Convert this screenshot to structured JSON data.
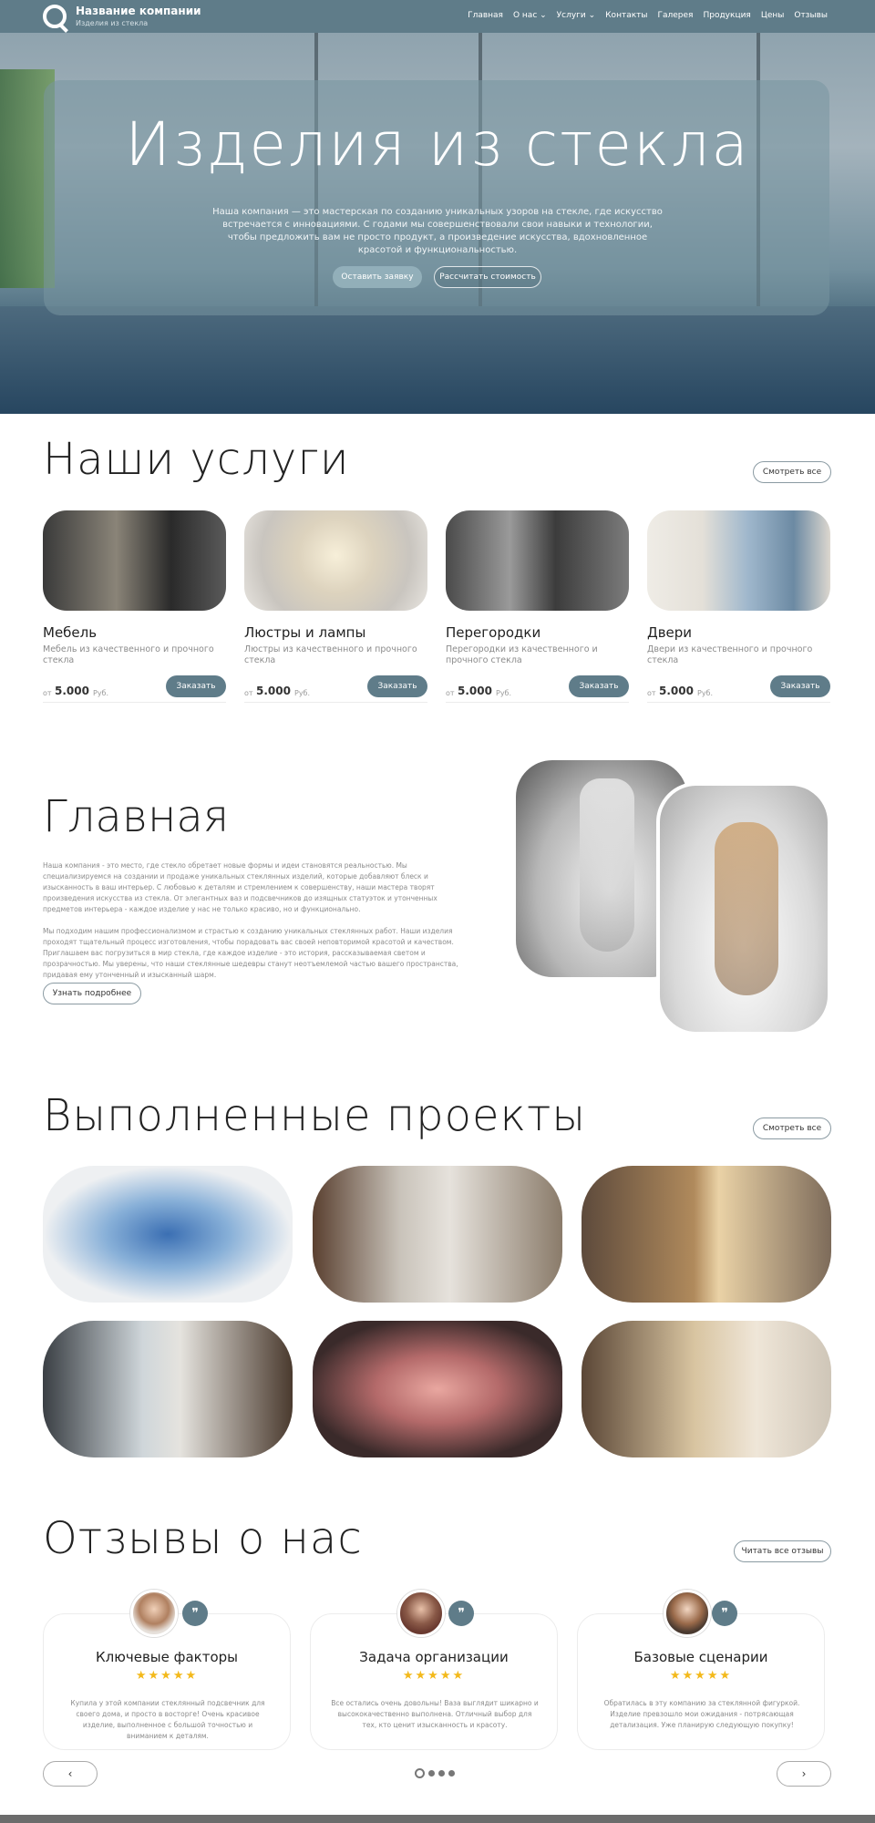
{
  "header": {
    "company_name": "Название компании",
    "company_tagline": "Изделия из стекла",
    "nav": [
      "Главная",
      "О нас ⌄",
      "Услуги ⌄",
      "Контакты",
      "Галерея",
      "Продукция",
      "Цены",
      "Отзывы"
    ]
  },
  "hero": {
    "title": "Изделия из стекла",
    "text": "Наша компания — это мастерская по созданию уникальных узоров на стекле, где искусство встречается с инновациями. С годами мы совершенствовали свои навыки и технологии, чтобы предложить вам не просто продукт, а произведение искусства, вдохновленное красотой и функциональностью.",
    "primary_button": "Оставить заявку",
    "secondary_button": "Рассчитать стоимость"
  },
  "services": {
    "title": "Наши услуги",
    "view_all": "Смотреть все",
    "items": [
      {
        "name": "Мебель",
        "desc": "Мебель из качественного и прочного стекла",
        "from": "от",
        "price": "5.000",
        "currency": "Руб.",
        "order": "Заказать"
      },
      {
        "name": "Люстры и лампы",
        "desc": "Люстры из качественного и прочного стекла",
        "from": "от",
        "price": "5.000",
        "currency": "Руб.",
        "order": "Заказать"
      },
      {
        "name": "Перегородки",
        "desc": "Перегородки из качественного и прочного стекла",
        "from": "от",
        "price": "5.000",
        "currency": "Руб.",
        "order": "Заказать"
      },
      {
        "name": "Двери",
        "desc": "Двери из качественного и прочного стекла",
        "from": "от",
        "price": "5.000",
        "currency": "Руб.",
        "order": "Заказать"
      }
    ]
  },
  "about": {
    "title": "Главная",
    "p1": "Наша компания - это место, где стекло обретает новые формы и идеи становятся реальностью. Мы специализируемся на создании и продаже уникальных стеклянных изделий, которые добавляют блеск и изысканность в ваш интерьер. С любовью к деталям и стремлением к совершенству, наши мастера творят произведения искусства из стекла. От элегантных ваз и подсвечников до изящных статуэток и утонченных предметов интерьера - каждое изделие у нас не только красиво, но и функционально.",
    "p2": "Мы подходим нашим профессионализмом и страстью к созданию уникальных стеклянных работ. Наши изделия проходят тщательный процесс изготовления, чтобы порадовать вас своей неповторимой красотой и качеством. Приглашаем вас погрузиться в мир стекла, где каждое изделие - это история, рассказываемая светом и прозрачностью. Мы уверены, что наши стеклянные шедевры станут неотъемлемой частью вашего пространства, придавая ему утонченный и изысканный шарм.",
    "button": "Узнать подробнее"
  },
  "projects": {
    "title": "Выполненные проекты",
    "view_all": "Смотреть все"
  },
  "reviews": {
    "title": "Отзывы о нас",
    "read_all": "Читать все отзывы",
    "stars": "★★★★★",
    "quote_icon": "❞",
    "items": [
      {
        "title": "Ключевые факторы",
        "text": "Купила у этой компании стеклянный подсвечник для своего дома, и просто в восторге! Очень красивое изделие, выполненное с большой точностью и вниманием к деталям."
      },
      {
        "title": "Задача организации",
        "text": "Все остались очень довольны! Ваза выглядит шикарно и высококачественно выполнена. Отличный выбор для тех, кто ценит изысканность и красоту."
      },
      {
        "title": "Базовые сценарии",
        "text": "Обратилась в эту компанию за стеклянной фигуркой. Изделие превзошло мои ожидания - потрясающая детализация. Уже планирую следующую покупку!"
      }
    ],
    "prev": "‹",
    "next": "›"
  }
}
